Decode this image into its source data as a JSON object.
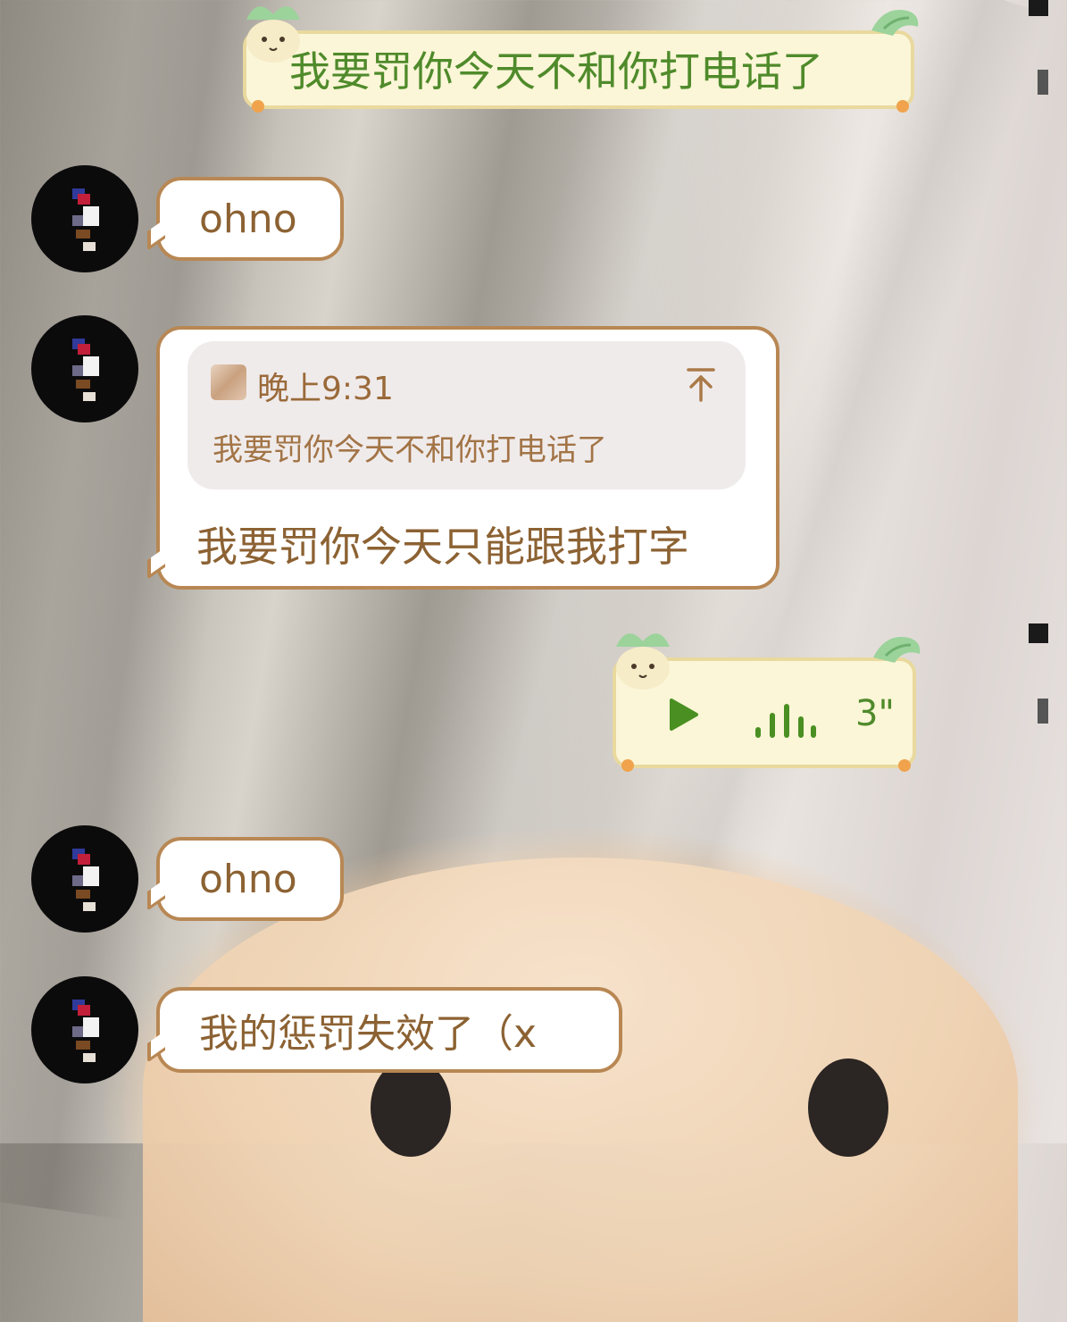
{
  "messages": {
    "m1": {
      "sender": "self",
      "text": "我要罚你今天不和你打电话了"
    },
    "m2": {
      "sender": "other",
      "text": "ohno"
    },
    "m3": {
      "sender": "other",
      "quote_time": "晚上9:31",
      "quote_text": "我要罚你今天不和你打电话了",
      "text": "我要罚你今天只能跟我打字"
    },
    "m4": {
      "sender": "self",
      "type": "voice",
      "duration": "3\""
    },
    "m5": {
      "sender": "other",
      "text": "ohno"
    },
    "m6": {
      "sender": "other",
      "text": "我的惩罚失效了（x"
    }
  },
  "colors": {
    "incoming_border": "#b88753",
    "incoming_text": "#8c6233",
    "outgoing_bg": "#fbf6d7",
    "outgoing_text": "#4f8a2b"
  },
  "icons": {
    "quote_jump": "arrow-up-to-line-icon",
    "voice_play": "play-icon",
    "voice_wave": "audio-wave-icon"
  }
}
